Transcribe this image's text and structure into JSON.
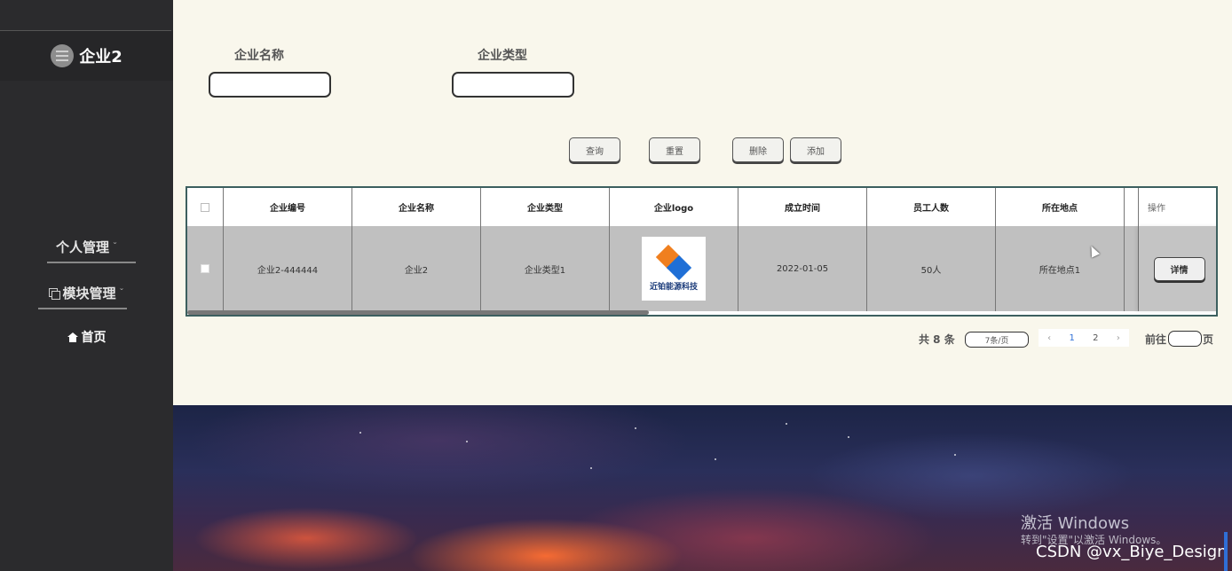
{
  "sidebar": {
    "brand": "企业2",
    "menu": [
      {
        "label": "个人管理",
        "chevron": "ˇ"
      },
      {
        "label": "模块管理",
        "chevron": "ˇ"
      }
    ],
    "home": "首页"
  },
  "search": {
    "name_label": "企业名称",
    "type_label": "企业类型",
    "name_value": "",
    "type_value": ""
  },
  "actions": {
    "query": "查询",
    "reset": "重置",
    "delete": "删除",
    "add": "添加"
  },
  "table": {
    "headers": [
      "企业编号",
      "企业名称",
      "企业类型",
      "企业logo",
      "成立时间",
      "员工人数",
      "所在地点",
      "操作"
    ],
    "rows": [
      {
        "code": "企业2-444444",
        "name": "企业2",
        "type": "企业类型1",
        "logo_text": "近铂能源科技",
        "founded": "2022-01-05",
        "staff": "50人",
        "location": "所在地点1",
        "detail": "详情"
      }
    ]
  },
  "pagination": {
    "total": "共 8 条",
    "page_size": "7条/页",
    "prev": "‹",
    "pages": [
      "1",
      "2"
    ],
    "current_page": "1",
    "next": "›",
    "goto_prefix": "前往",
    "goto_suffix": "页"
  },
  "overlay": {
    "activate_title": "激活 Windows",
    "activate_sub": "转到\"设置\"以激活 Windows。",
    "credit": "CSDN @vx_Biye_Design"
  },
  "colors": {
    "sidebar": "#2b2b2d",
    "page_bg": "#f9f7ec",
    "table_border": "#3c5f5f",
    "row_bg": "#c0c0c0",
    "active_page": "#2f6fd6"
  }
}
